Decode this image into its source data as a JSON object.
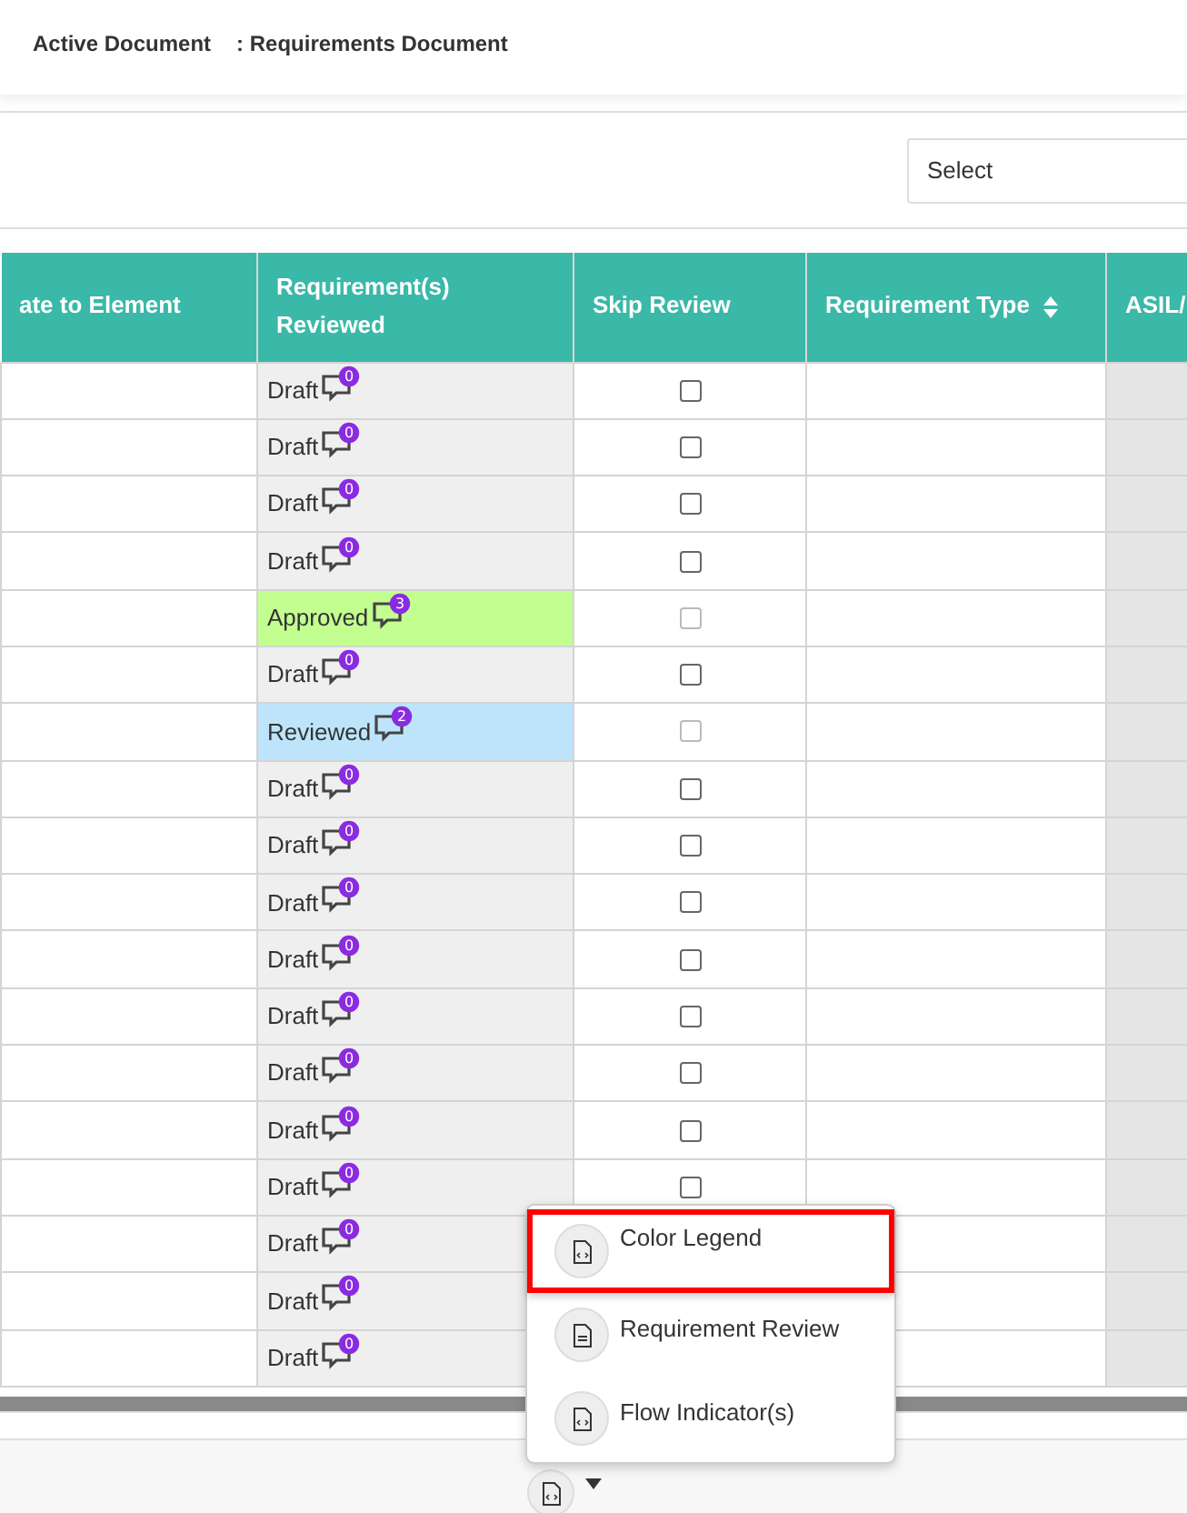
{
  "header": {
    "label": "Active Document",
    "value": ": Requirements Document"
  },
  "filter": {
    "placeholder": "Select"
  },
  "table": {
    "columns": [
      {
        "label": "ate to Element",
        "sorted": false
      },
      {
        "label": "Requirement(s) Reviewed",
        "sorted": false
      },
      {
        "label": "Skip Review",
        "sorted": false
      },
      {
        "label": "Requirement Type",
        "sorted": true
      },
      {
        "label": "ASIL/",
        "sorted": false
      }
    ],
    "rows": [
      {
        "status": "Draft",
        "color": "#efefef",
        "comments": "0",
        "skip": {
          "checked": false,
          "disabled": false
        }
      },
      {
        "status": "Draft",
        "color": "#efefef",
        "comments": "0",
        "skip": {
          "checked": false,
          "disabled": false
        }
      },
      {
        "status": "Draft",
        "color": "#efefef",
        "comments": "0",
        "skip": {
          "checked": false,
          "disabled": false
        }
      },
      {
        "status": "Draft",
        "color": "#efefef",
        "comments": "0",
        "skip": {
          "checked": false,
          "disabled": false
        }
      },
      {
        "status": "Approved",
        "color": "#c2ff90",
        "comments": "3",
        "skip": {
          "checked": false,
          "disabled": true
        }
      },
      {
        "status": "Draft",
        "color": "#efefef",
        "comments": "0",
        "skip": {
          "checked": false,
          "disabled": false
        }
      },
      {
        "status": "Reviewed",
        "color": "#bde4fa",
        "comments": "2",
        "skip": {
          "checked": false,
          "disabled": true
        }
      },
      {
        "status": "Draft",
        "color": "#efefef",
        "comments": "0",
        "skip": {
          "checked": false,
          "disabled": false
        }
      },
      {
        "status": "Draft",
        "color": "#efefef",
        "comments": "0",
        "skip": {
          "checked": false,
          "disabled": false
        }
      },
      {
        "status": "Draft",
        "color": "#efefef",
        "comments": "0",
        "skip": {
          "checked": false,
          "disabled": false
        }
      },
      {
        "status": "Draft",
        "color": "#efefef",
        "comments": "0",
        "skip": {
          "checked": false,
          "disabled": false
        }
      },
      {
        "status": "Draft",
        "color": "#efefef",
        "comments": "0",
        "skip": {
          "checked": false,
          "disabled": false
        }
      },
      {
        "status": "Draft",
        "color": "#efefef",
        "comments": "0",
        "skip": {
          "checked": false,
          "disabled": false
        }
      },
      {
        "status": "Draft",
        "color": "#efefef",
        "comments": "0",
        "skip": {
          "checked": false,
          "disabled": false
        }
      },
      {
        "status": "Draft",
        "color": "#efefef",
        "comments": "0",
        "skip": {
          "checked": false,
          "disabled": false
        }
      },
      {
        "status": "Draft",
        "color": "#efefef",
        "comments": "0"
      },
      {
        "status": "Draft",
        "color": "#efefef",
        "comments": "0"
      },
      {
        "status": "Draft",
        "color": "#efefef",
        "comments": "0"
      }
    ]
  },
  "menu": {
    "items": [
      {
        "label": "Color Legend",
        "kind": "code",
        "highlighted": true
      },
      {
        "label": "Requirement Review",
        "kind": "text",
        "highlighted": false
      },
      {
        "label": "Flow Indicator(s)",
        "kind": "code",
        "highlighted": false
      }
    ]
  }
}
